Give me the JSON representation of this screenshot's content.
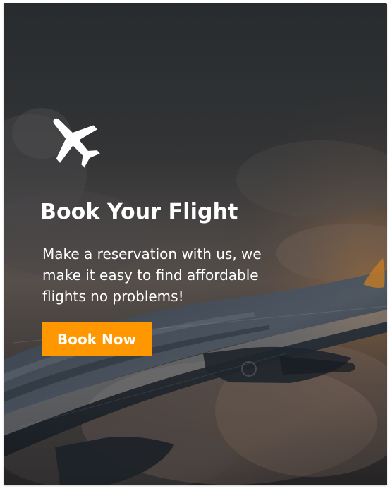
{
  "hero": {
    "title": "Book Your Flight",
    "description": "Make a reservation with us, we make it easy to find affordable flights no problems!",
    "button_label": "Book Now",
    "icon": "airplane-icon",
    "background_image": "airplane-wing-over-clouds-photo"
  },
  "colors": {
    "button": "#ff9800",
    "text": "#ffffff"
  }
}
